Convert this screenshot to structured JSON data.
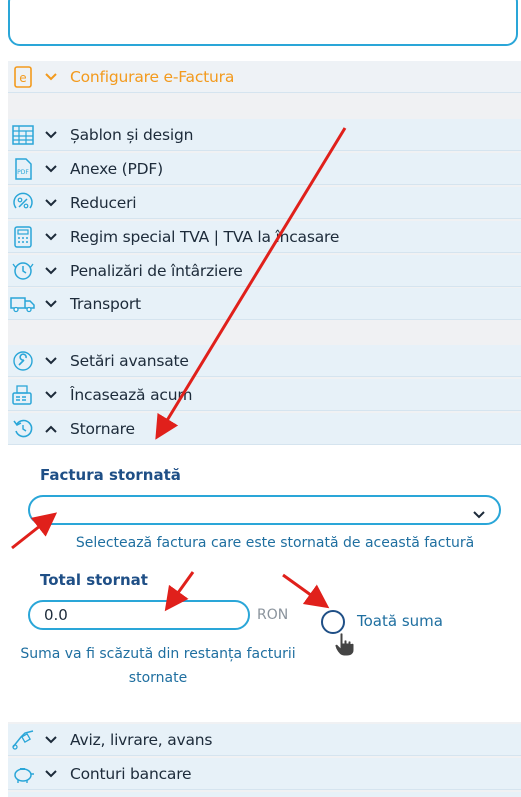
{
  "sections": {
    "einvoice": {
      "label": "Configurare e-Factura",
      "color": "#f39a1d"
    },
    "group1": [
      {
        "label": "Șablon și design",
        "icon": "template-grid-icon"
      },
      {
        "label": "Anexe (PDF)",
        "icon": "pdf-file-icon"
      },
      {
        "label": "Reduceri",
        "icon": "discount-icon"
      },
      {
        "label": "Regim special TVA | TVA la încasare",
        "icon": "calculator-icon"
      },
      {
        "label": "Penalizări de întârziere",
        "icon": "late-penalty-icon"
      },
      {
        "label": "Transport",
        "icon": "truck-icon"
      }
    ],
    "group2": [
      {
        "label": "Setări avansate",
        "icon": "wrench-icon"
      },
      {
        "label": "Încasează acum",
        "icon": "cash-register-icon"
      },
      {
        "label": "Stornare",
        "icon": "undo-circle-icon"
      }
    ],
    "group3": [
      {
        "label": "Aviz, livrare, avans",
        "icon": "hand-truck-icon"
      },
      {
        "label": "Conturi bancare",
        "icon": "piggy-bank-icon"
      }
    ]
  },
  "storno": {
    "invoice_title": "Factura stornată",
    "invoice_select_value": "",
    "invoice_hint": "Selectează factura care este stornată de această factură",
    "total_title": "Total stornat",
    "total_value": "0.0",
    "currency": "RON",
    "whole_amount_label": "Toată suma",
    "whole_amount_checked": false,
    "total_hint_line1": "Suma va fi scăzută din restanța facturii",
    "total_hint_line2": "stornate"
  },
  "colors": {
    "accent": "#2aa6d8",
    "title": "#1f4f86",
    "hint": "#1f6fa0",
    "annotation_arrow": "#e0201b"
  }
}
